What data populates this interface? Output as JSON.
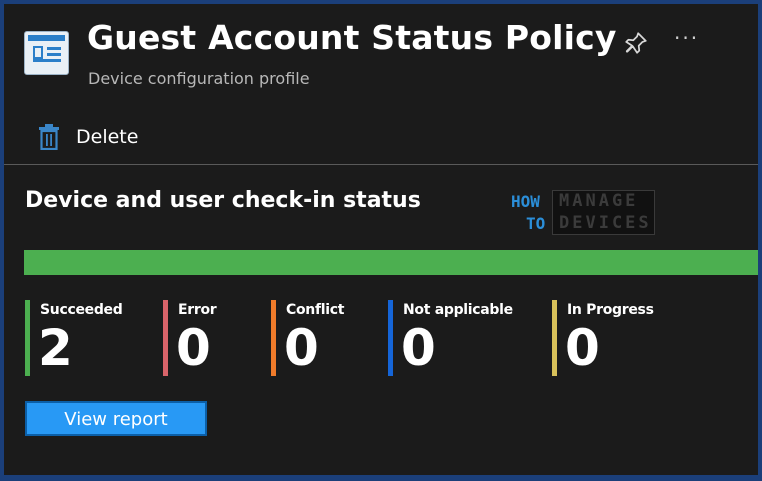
{
  "header": {
    "title": "Guest Account Status Policy",
    "subtitle": "Device configuration profile",
    "profile_icon": "profile-config-icon",
    "pin_icon": "pin-icon",
    "more_label": "···"
  },
  "toolbar": {
    "delete_label": "Delete",
    "delete_icon": "trash-icon"
  },
  "section": {
    "title": "Device and user check-in status"
  },
  "logo": {
    "line1": "HOW",
    "line2": "TO",
    "line3": "MANAGE",
    "line4": "DEVICES"
  },
  "progress": {
    "succeeded_fraction": 1.0,
    "color": "#4caf50"
  },
  "stats": [
    {
      "label": "Succeeded",
      "value": "2",
      "color": "#4caf50"
    },
    {
      "label": "Error",
      "value": "0",
      "color": "#d9646a"
    },
    {
      "label": "Conflict",
      "value": "0",
      "color": "#f07b2a"
    },
    {
      "label": "Not applicable",
      "value": "0",
      "color": "#1565d8"
    },
    {
      "label": "In Progress",
      "value": "0",
      "color": "#d8c15a"
    }
  ],
  "actions": {
    "view_report_label": "View report"
  },
  "colors": {
    "background": "#1b1b1b",
    "border": "#1b3f7a",
    "accent": "#2899f5"
  }
}
